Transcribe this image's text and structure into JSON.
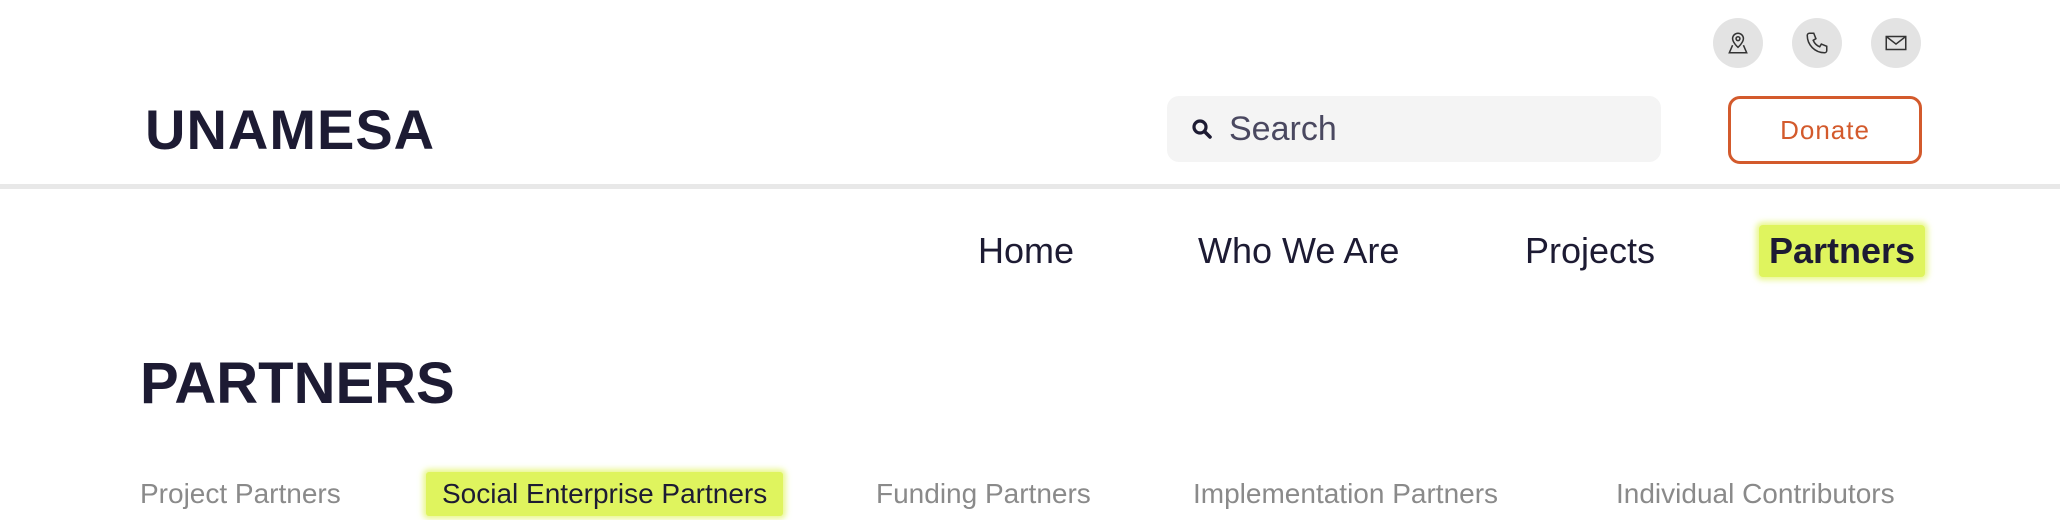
{
  "contact_icons": [
    {
      "name": "map-pin-icon"
    },
    {
      "name": "phone-icon"
    },
    {
      "name": "mail-icon"
    }
  ],
  "header": {
    "logo": "UNAMESA",
    "search_placeholder": "Search",
    "donate_label": "Donate"
  },
  "nav": {
    "items": [
      "Home",
      "Who We Are",
      "Projects",
      "Partners"
    ],
    "active": "Partners"
  },
  "page": {
    "title": "PARTNERS"
  },
  "tabs": {
    "items": [
      "Project Partners",
      "Social Enterprise Partners",
      "Funding Partners",
      "Implementation Partners",
      "Individual Contributors"
    ],
    "active": "Social Enterprise Partners"
  },
  "colors": {
    "text": "#1d1b33",
    "accent_highlight": "#dff45e",
    "donate": "#d35a2c",
    "tab_inactive": "#8a8a8a"
  }
}
